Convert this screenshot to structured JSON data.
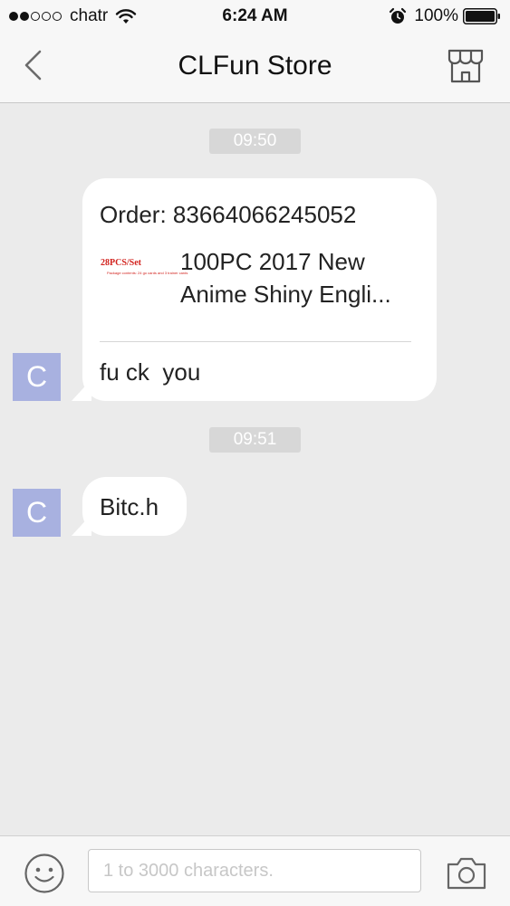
{
  "status_bar": {
    "carrier": "chatr",
    "time": "6:24 AM",
    "battery_percent": "100%",
    "signal_bars_filled": 2,
    "signal_bars_total": 5
  },
  "nav": {
    "title": "CLFun Store",
    "back_icon": "chevron-left-icon",
    "store_icon": "storefront-icon"
  },
  "messages": [
    {
      "timestamp": "09:50",
      "avatar_letter": "C",
      "order_number": "Order: 83664066245052",
      "product": {
        "thumb_title": "28PCS/Set",
        "thumb_subtitle": "Package contents: 24 go cards and 3 trainer cards",
        "title": "100PC 2017 New Anime Shiny Engli..."
      },
      "text": "fu ck  you"
    },
    {
      "timestamp": "09:51",
      "avatar_letter": "C",
      "text": "Bitc.h"
    }
  ],
  "input_bar": {
    "placeholder": "1 to 3000 characters.",
    "value": "",
    "emoji_icon": "smiley-icon",
    "camera_icon": "camera-icon"
  },
  "colors": {
    "background": "#ebebeb",
    "bar_background": "#f7f7f7",
    "avatar": "#a8b1e0",
    "timestamp_chip": "#d7d7d7",
    "bubble": "#ffffff"
  }
}
